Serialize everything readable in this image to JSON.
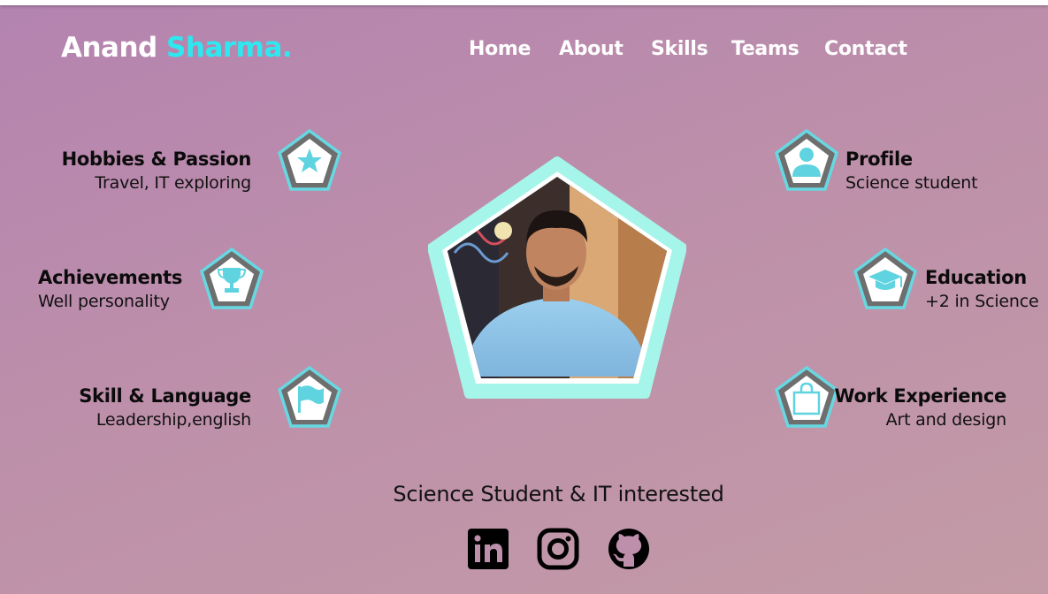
{
  "logo": {
    "first": "Anand",
    "last": "Sharma."
  },
  "nav": [
    "Home",
    "About",
    "Skills",
    "Teams",
    "Contact"
  ],
  "cards": {
    "hobbies": {
      "title": "Hobbies & Passion",
      "subtitle": "Travel, IT exploring",
      "icon": "star-icon"
    },
    "achievements": {
      "title": "Achievements",
      "subtitle": "Well personality",
      "icon": "trophy-icon"
    },
    "skills": {
      "title": "Skill & Language",
      "subtitle": "Leadership,english",
      "icon": "flag-icon"
    },
    "profile": {
      "title": "Profile",
      "subtitle": "Science student",
      "icon": "user-icon"
    },
    "education": {
      "title": "Education",
      "subtitle": "+2 in Science",
      "icon": "graduation-cap-icon"
    },
    "work": {
      "title": "Work Experience",
      "subtitle": "Art and design",
      "icon": "shopping-bag-icon"
    }
  },
  "tagline": "Science Student & IT interested",
  "social": [
    "linkedin-icon",
    "instagram-icon",
    "github-icon"
  ],
  "colors": {
    "accent": "#2ee8f0",
    "pentagon_border": "#67d8e2",
    "pentagon_fill": "#6e6e6e",
    "photo_frame": "#a6f5ea"
  }
}
